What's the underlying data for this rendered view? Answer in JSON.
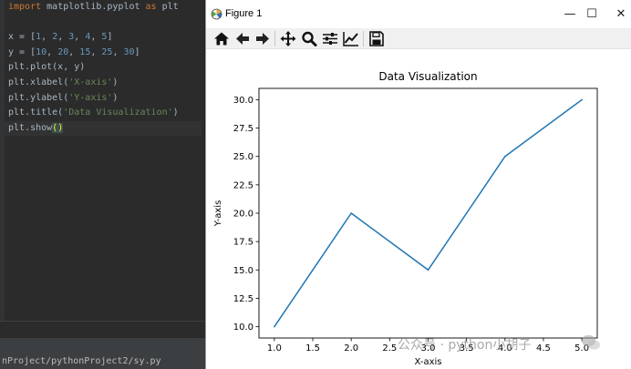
{
  "editor": {
    "lines": [
      {
        "parts": [
          {
            "t": "import ",
            "c": "kw"
          },
          {
            "t": "matplotlib.pyplot ",
            "c": ""
          },
          {
            "t": "as ",
            "c": "kw"
          },
          {
            "t": "plt",
            "c": ""
          }
        ]
      },
      {
        "parts": []
      },
      {
        "parts": [
          {
            "t": "x = [",
            "c": ""
          },
          {
            "t": "1",
            "c": "num"
          },
          {
            "t": ", ",
            "c": ""
          },
          {
            "t": "2",
            "c": "num"
          },
          {
            "t": ", ",
            "c": ""
          },
          {
            "t": "3",
            "c": "num"
          },
          {
            "t": ", ",
            "c": ""
          },
          {
            "t": "4",
            "c": "num"
          },
          {
            "t": ", ",
            "c": ""
          },
          {
            "t": "5",
            "c": "num"
          },
          {
            "t": "]",
            "c": ""
          }
        ]
      },
      {
        "parts": [
          {
            "t": "y = [",
            "c": ""
          },
          {
            "t": "10",
            "c": "num"
          },
          {
            "t": ", ",
            "c": ""
          },
          {
            "t": "20",
            "c": "num"
          },
          {
            "t": ", ",
            "c": ""
          },
          {
            "t": "15",
            "c": "num"
          },
          {
            "t": ", ",
            "c": ""
          },
          {
            "t": "25",
            "c": "num"
          },
          {
            "t": ", ",
            "c": ""
          },
          {
            "t": "30",
            "c": "num"
          },
          {
            "t": "]",
            "c": ""
          }
        ]
      },
      {
        "parts": [
          {
            "t": "plt.plot(x, y)",
            "c": ""
          }
        ]
      },
      {
        "parts": [
          {
            "t": "plt.xlabel(",
            "c": ""
          },
          {
            "t": "'X-axis'",
            "c": "str"
          },
          {
            "t": ")",
            "c": ""
          }
        ]
      },
      {
        "parts": [
          {
            "t": "plt.ylabel(",
            "c": ""
          },
          {
            "t": "'Y-axis'",
            "c": "str"
          },
          {
            "t": ")",
            "c": ""
          }
        ]
      },
      {
        "parts": [
          {
            "t": "plt.title(",
            "c": ""
          },
          {
            "t": "'Data Visualization'",
            "c": "str"
          },
          {
            "t": ")",
            "c": ""
          }
        ]
      },
      {
        "parts": [
          {
            "t": "plt.show",
            "c": ""
          },
          {
            "t": "()",
            "c": "paren-hl"
          }
        ],
        "current": true
      }
    ],
    "status_path": "nProject/pythonProject2/sy.py"
  },
  "window": {
    "title": "Figure 1",
    "minimize_glyph": "—",
    "maximize_glyph": "☐",
    "close_glyph": "✕"
  },
  "toolbar": {
    "buttons": [
      {
        "name": "home-icon"
      },
      {
        "name": "back-arrow-icon"
      },
      {
        "name": "forward-arrow-icon"
      },
      {
        "name": "pan-icon"
      },
      {
        "name": "zoom-icon"
      },
      {
        "name": "configure-subplots-icon"
      },
      {
        "name": "edit-axis-icon"
      },
      {
        "name": "save-icon"
      }
    ]
  },
  "chart_data": {
    "type": "line",
    "title": "Data Visualization",
    "xlabel": "X-axis",
    "ylabel": "Y-axis",
    "x": [
      1,
      2,
      3,
      4,
      5
    ],
    "series": [
      {
        "values": [
          10,
          20,
          15,
          25,
          30
        ],
        "color": "#1f77b4"
      }
    ],
    "xlim": [
      0.8,
      5.2
    ],
    "ylim": [
      9,
      31
    ],
    "xticks": [
      1.0,
      1.5,
      2.0,
      2.5,
      3.0,
      3.5,
      4.0,
      4.5,
      5.0
    ],
    "xtick_labels": [
      "1.0",
      "1.5",
      "2.0",
      "2.5",
      "3.0",
      "3.5",
      "4.0",
      "4.5",
      "5.0"
    ],
    "yticks": [
      10.0,
      12.5,
      15.0,
      17.5,
      20.0,
      22.5,
      25.0,
      27.5,
      30.0
    ],
    "ytick_labels": [
      "10.0",
      "12.5",
      "15.0",
      "17.5",
      "20.0",
      "22.5",
      "25.0",
      "27.5",
      "30.0"
    ],
    "grid": false
  },
  "watermark": {
    "text": "公众号 · python小胡子"
  }
}
